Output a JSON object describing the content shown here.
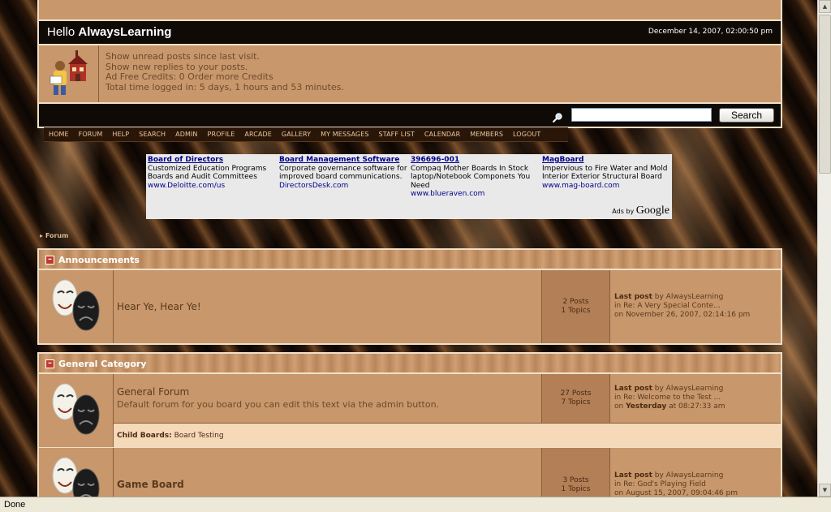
{
  "header": {
    "greeting_prefix": "Hello",
    "username": "AlwaysLearning",
    "datetime": "December 14, 2007, 02:00:50 pm"
  },
  "info": {
    "lines": [
      "Show unread posts since last visit.",
      "Show new replies to your posts.",
      "Ad Free Credits: 0 Order more Credits",
      "Total time logged in: 5 days, 1 hours and 53 minutes."
    ]
  },
  "search": {
    "value": "",
    "button_label": "Search"
  },
  "nav": {
    "items": [
      "HOME",
      "FORUM",
      "HELP",
      "SEARCH",
      "ADMIN",
      "PROFILE",
      "ARCADE",
      "GALLERY",
      "MY MESSAGES",
      "STAFF LIST",
      "CALENDAR",
      "MEMBERS",
      "LOGOUT"
    ]
  },
  "ads": {
    "items": [
      {
        "title": "Board of Directors",
        "text": "Customized Education Programs Boards and Audit Committees",
        "url": "www.Deloitte.com/us"
      },
      {
        "title": "Board Management Software",
        "text": "Corporate governance software for improved board communications.",
        "url": "DirectorsDesk.com"
      },
      {
        "title": "396696-001",
        "text": "Compaq Mother Boards In Stock laptop/Notebook Componets You Need",
        "url": "www.blueraven.com"
      },
      {
        "title": "MagBoard",
        "text": "Impervious to Fire Water and Mold Interior Exterior Structural Board",
        "url": "www.mag-board.com"
      }
    ],
    "ads_by": "Ads by",
    "brand": "Google"
  },
  "breadcrumb": "Forum",
  "categories": [
    {
      "name": "Announcements",
      "forums": [
        {
          "name": "Hear Ye, Hear Ye!",
          "description": "",
          "posts": "2 Posts",
          "topics": "1 Topics",
          "last_post_label": "Last post",
          "last_post_by": "by AlwaysLearning",
          "last_post_in": "in Re: A Very Special Conte...",
          "last_post_on": "on November 26, 2007, 02:14:16 pm"
        }
      ]
    },
    {
      "name": "General Category",
      "forums": [
        {
          "name": "General Forum",
          "description": "Default forum for you board you can edit this text via the admin button.",
          "posts": "27 Posts",
          "topics": "7 Topics",
          "last_post_label": "Last post",
          "last_post_by": "by AlwaysLearning",
          "last_post_in": "in Re: Welcome to the Test ...",
          "last_post_on_prefix": "on",
          "last_post_on_day": "Yesterday",
          "last_post_on_time": "at 08:27:33 am",
          "child_boards_label": "Child Boards:",
          "child_boards": "Board Testing"
        },
        {
          "name": "Game Board",
          "description": "",
          "posts": "3 Posts",
          "topics": "1 Topics",
          "last_post_label": "Last post",
          "last_post_by": "by AlwaysLearning",
          "last_post_in": "in Re: God's Playing Field",
          "last_post_on": "on August 15, 2007, 09:04:46 pm"
        }
      ]
    }
  ],
  "statusbar": "Done",
  "icons": {
    "avatar": "reading-student-schoolhouse-icon",
    "forum": "theater-masks-icon",
    "search": "magnifier-icon",
    "collapse": "minus-icon"
  },
  "colors": {
    "panel": "#c8976b",
    "header_dark": "#100a06",
    "border": "#f0e0c8",
    "child_row": "#f5d9b9"
  }
}
